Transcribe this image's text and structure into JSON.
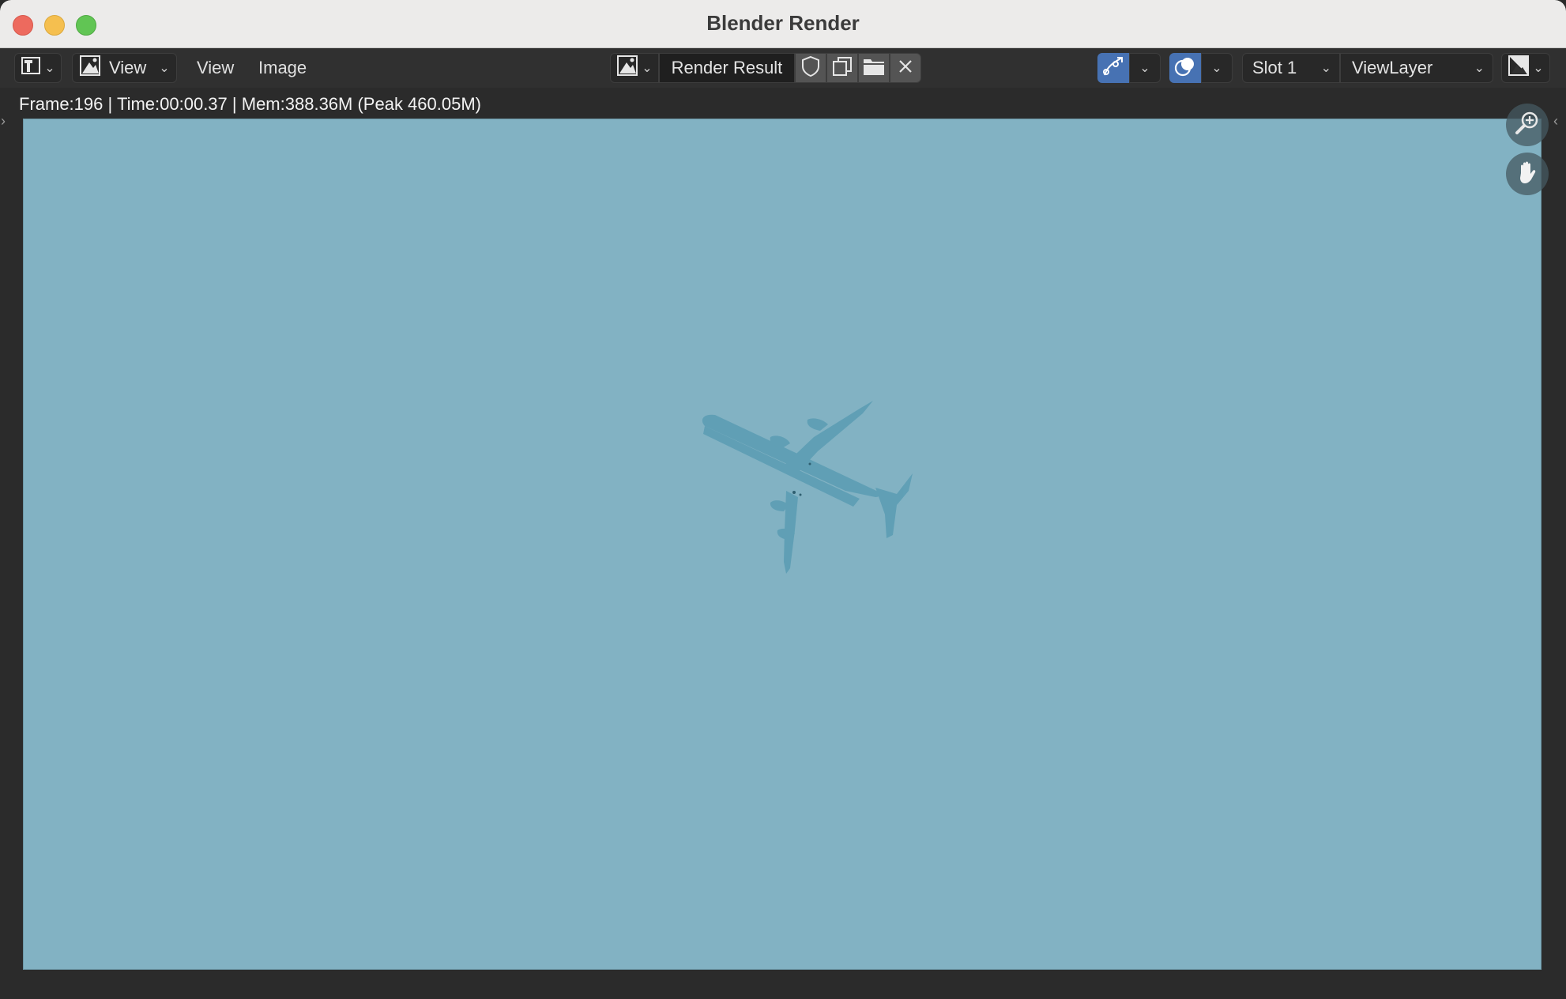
{
  "window": {
    "title": "Blender Render"
  },
  "header": {
    "editor_type_icon": "image-editor-icon",
    "view_mode_label": "View",
    "menus": [
      "View",
      "Image"
    ],
    "image_name": "Render Result",
    "slot_label": "Slot 1",
    "view_layer_label": "ViewLayer"
  },
  "status": {
    "frame": "Frame:196",
    "time": "Time:00:00.37",
    "mem": "Mem:388.36M (Peak 460.05M)",
    "separator": "|"
  },
  "viewport": {
    "background_color": "#82b2c3",
    "subject": "airplane-silhouette"
  },
  "colors": {
    "accent_blue": "#4772b3",
    "panel": "#303030",
    "titlebar": "#ecebea"
  }
}
